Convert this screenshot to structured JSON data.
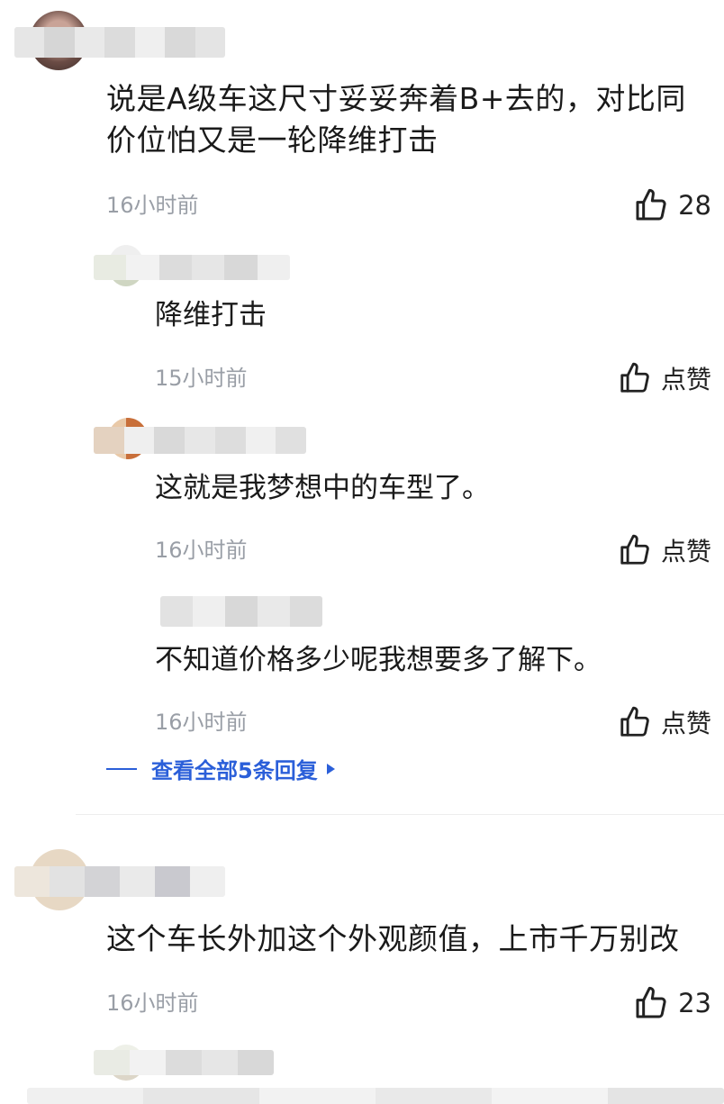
{
  "comments": [
    {
      "text_lines": [
        "说是A级车这尺寸妥妥奔着B+去的，对比同",
        "价位怕又是一轮降维打击"
      ],
      "time": "16小时前",
      "likes": "28",
      "replies": [
        {
          "text": "降维打击",
          "time": "15小时前",
          "like_label": "点赞"
        },
        {
          "text": "这就是我梦想中的车型了。",
          "time": "16小时前",
          "like_label": "点赞"
        },
        {
          "text": "不知道价格多少呢我想要多了解下。",
          "time": "16小时前",
          "like_label": "点赞"
        }
      ],
      "view_all_label": "查看全部5条回复"
    },
    {
      "text_lines": [
        "这个车长外加这个外观颜值，上市千万别改"
      ],
      "time": "16小时前",
      "likes": "23"
    }
  ],
  "icons": {
    "like": "thumbs-up-icon",
    "expand": "triangle-right-icon"
  },
  "colors": {
    "text": "#1a1a1a",
    "time": "#999ea6",
    "link": "#2b5fd9"
  }
}
